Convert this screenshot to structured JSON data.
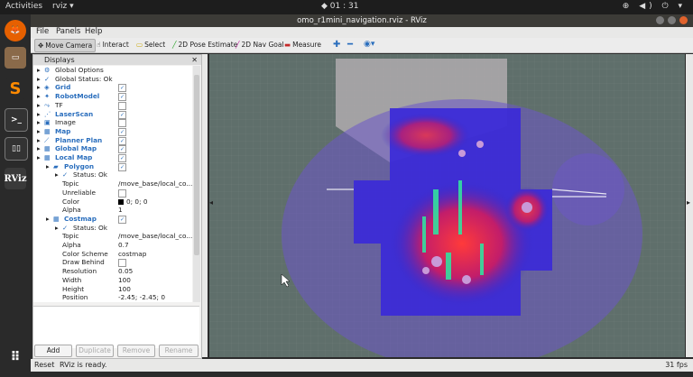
{
  "topbar": {
    "activities": "Activities",
    "app_menu": "rviz ▾",
    "clock": "◆ 01 : 31",
    "tray": "⊕ ◀) ⏻ ▾"
  },
  "window": {
    "title": "omo_r1mini_navigation.rviz - RViz"
  },
  "menu": {
    "file": "File",
    "panels": "Panels",
    "help": "Help"
  },
  "toolbar": {
    "move_camera": "Move Camera",
    "interact": "Interact",
    "select": "Select",
    "pose_estimate": "2D Pose Estimate",
    "nav_goal": "2D Nav Goal",
    "measure": "Measure"
  },
  "displays": {
    "title": "Displays",
    "rows": [
      {
        "label": "Global Options",
        "indent": 0,
        "value": ""
      },
      {
        "label": "Global Status: Ok",
        "indent": 0,
        "value": ""
      },
      {
        "label": "Grid",
        "indent": 0,
        "value": "✓"
      },
      {
        "label": "RobotModel",
        "indent": 0,
        "value": "✓"
      },
      {
        "label": "TF",
        "indent": 0,
        "value": ""
      },
      {
        "label": "LaserScan",
        "indent": 0,
        "value": "✓"
      },
      {
        "label": "Image",
        "indent": 0,
        "value": ""
      },
      {
        "label": "Map",
        "indent": 0,
        "value": "✓"
      },
      {
        "label": "Planner Plan",
        "indent": 0,
        "value": "✓"
      },
      {
        "label": "Global Map",
        "indent": 0,
        "value": "✓"
      },
      {
        "label": "Local Map",
        "indent": 0,
        "value": "✓"
      },
      {
        "label": "Polygon",
        "indent": 1,
        "value": "✓"
      },
      {
        "label": "Status: Ok",
        "indent": 2,
        "value": ""
      },
      {
        "label": "Topic",
        "indent": 2,
        "value": "/move_base/local_co..."
      },
      {
        "label": "Unreliable",
        "indent": 2,
        "value": ""
      },
      {
        "label": "Color",
        "indent": 2,
        "value": "0; 0; 0"
      },
      {
        "label": "Alpha",
        "indent": 2,
        "value": "1"
      },
      {
        "label": "Costmap",
        "indent": 1,
        "value": "✓"
      },
      {
        "label": "Status: Ok",
        "indent": 2,
        "value": ""
      },
      {
        "label": "Topic",
        "indent": 2,
        "value": "/move_base/local_co..."
      },
      {
        "label": "Alpha",
        "indent": 2,
        "value": "0.7"
      },
      {
        "label": "Color Scheme",
        "indent": 2,
        "value": "costmap"
      },
      {
        "label": "Draw Behind",
        "indent": 2,
        "value": ""
      },
      {
        "label": "Resolution",
        "indent": 2,
        "value": "0.05"
      },
      {
        "label": "Width",
        "indent": 2,
        "value": "100"
      },
      {
        "label": "Height",
        "indent": 2,
        "value": "100"
      },
      {
        "label": "Position",
        "indent": 2,
        "value": "-2.45; -2.45; 0"
      }
    ]
  },
  "buttons": {
    "add": "Add",
    "duplicate": "Duplicate",
    "remove": "Remove",
    "rename": "Rename"
  },
  "status": {
    "reset": "Reset",
    "message": "RViz is ready.",
    "fps": "31 fps"
  },
  "dock": {
    "rviz_label": "RViz"
  }
}
